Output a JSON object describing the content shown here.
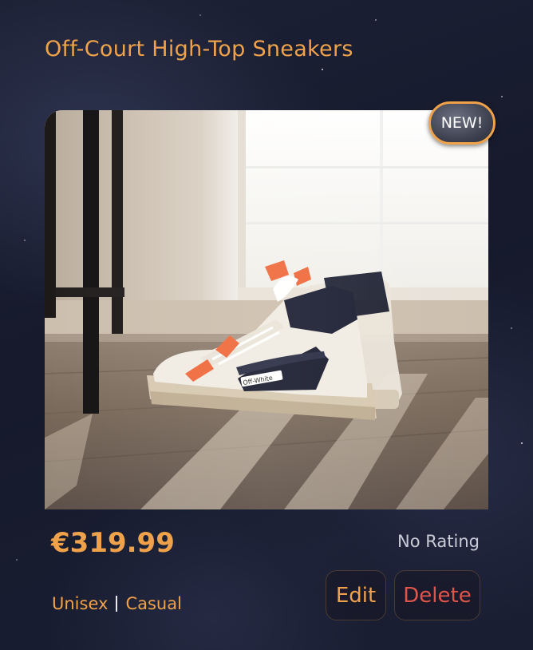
{
  "product": {
    "title": "Off-Court High-Top Sneakers",
    "badge": "NEW!",
    "price": "€319.99",
    "rating": "No Rating",
    "tags": [
      "Unisex",
      "Casual"
    ],
    "image_alt": "Off-White sneaker on wooden floor",
    "shoe_label": "Off-White"
  },
  "actions": {
    "edit_label": "Edit",
    "delete_label": "Delete"
  },
  "colors": {
    "accent": "#f0a24a",
    "danger": "#e0554a",
    "background": "#1a1e31",
    "muted_text": "#c9cbd6"
  }
}
